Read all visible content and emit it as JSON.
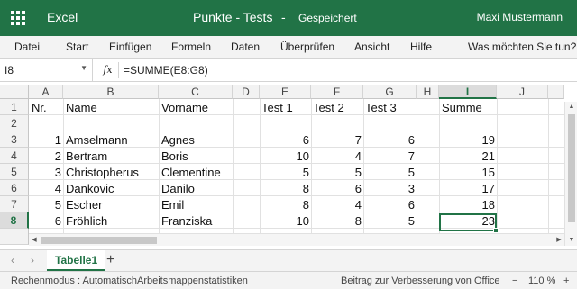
{
  "titlebar": {
    "app_name": "Excel",
    "doc_title": "Punkte - Tests",
    "separator": "-",
    "doc_status": "Gespeichert",
    "user_name": "Maxi Mustermann"
  },
  "menu": {
    "items": [
      "Datei",
      "Start",
      "Einfügen",
      "Formeln",
      "Daten",
      "Überprüfen",
      "Ansicht",
      "Hilfe"
    ],
    "tell_me": "Was möchten Sie tun?"
  },
  "formula_bar": {
    "name_box": "I8",
    "fx_label": "fx",
    "formula": "=SUMME(E8:G8)"
  },
  "sheet": {
    "columns": [
      "A",
      "B",
      "C",
      "D",
      "E",
      "F",
      "G",
      "H",
      "I",
      "J"
    ],
    "selected_column": "I",
    "rows": [
      "1",
      "2",
      "3",
      "4",
      "5",
      "6",
      "7",
      "8"
    ],
    "selected_row": "8",
    "headers": {
      "nr": "Nr.",
      "name": "Name",
      "vorname": "Vorname",
      "test1": "Test 1",
      "test2": "Test 2",
      "test3": "Test 3",
      "summe": "Summe"
    },
    "data": [
      {
        "nr": "1",
        "name": "Amselmann",
        "vorname": "Agnes",
        "t1": "6",
        "t2": "7",
        "t3": "6",
        "sum": "19"
      },
      {
        "nr": "2",
        "name": "Bertram",
        "vorname": "Boris",
        "t1": "10",
        "t2": "4",
        "t3": "7",
        "sum": "21"
      },
      {
        "nr": "3",
        "name": "Christopherus",
        "vorname": "Clementine",
        "t1": "5",
        "t2": "5",
        "t3": "5",
        "sum": "15"
      },
      {
        "nr": "4",
        "name": "Dankovic",
        "vorname": "Danilo",
        "t1": "8",
        "t2": "6",
        "t3": "3",
        "sum": "17"
      },
      {
        "nr": "5",
        "name": "Escher",
        "vorname": "Emil",
        "t1": "8",
        "t2": "4",
        "t3": "6",
        "sum": "18"
      },
      {
        "nr": "6",
        "name": "Fröhlich",
        "vorname": "Franziska",
        "t1": "10",
        "t2": "8",
        "t3": "5",
        "sum": "23"
      }
    ]
  },
  "tabs": {
    "sheets": [
      "Tabelle1"
    ],
    "add_label": "+"
  },
  "statusbar": {
    "calc_mode": "Rechenmodus : Automatisch",
    "stats": "Arbeitsmappenstatistiken",
    "feedback": "Beitrag zur Verbesserung von Office",
    "zoom_minus": "−",
    "zoom": "110 %",
    "zoom_plus": "+"
  },
  "colors": {
    "accent": "#217346"
  }
}
